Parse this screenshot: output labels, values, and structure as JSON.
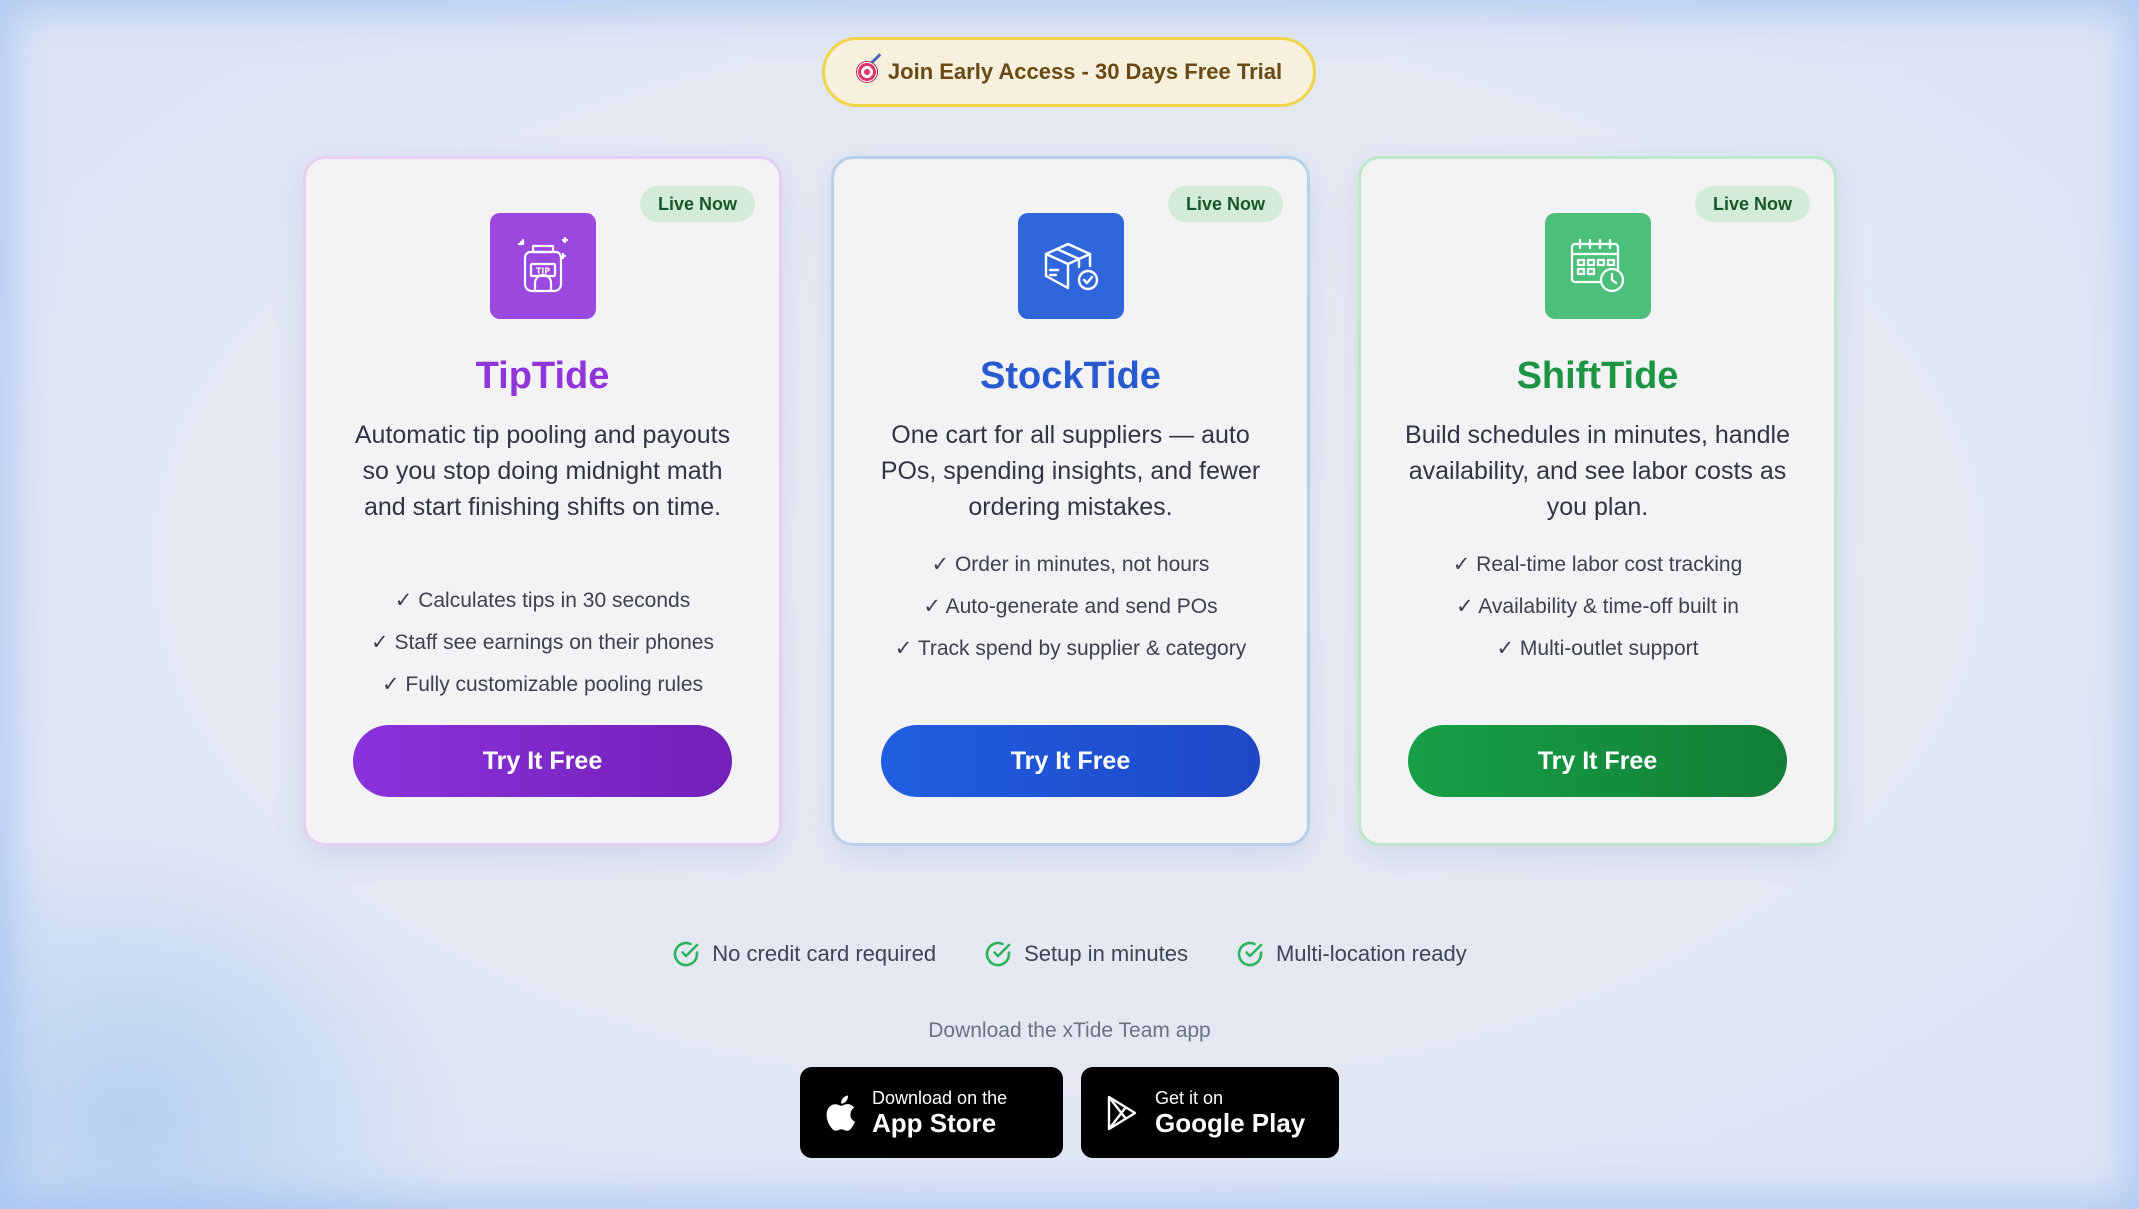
{
  "banner": {
    "text": "Join Early Access - 30 Days Free Trial",
    "icon": "target-icon"
  },
  "colors": {
    "purple": "#9b48df",
    "blue": "#2f67db",
    "green": "#4cc07a",
    "badge_border": "#f2d44a"
  },
  "cards": [
    {
      "badge": "Live Now",
      "name": "TipTide",
      "icon": "tip-jar-icon",
      "description": "Automatic tip pooling and payouts so you stop doing midnight math and start finishing shifts on time.",
      "features": [
        "✓ Calculates tips in 30 seconds",
        "✓ Staff see earnings on their phones",
        "✓ Fully customizable pooling rules"
      ],
      "cta": "Try It Free"
    },
    {
      "badge": "Live Now",
      "name": "StockTide",
      "icon": "box-check-icon",
      "description": "One cart for all suppliers — auto POs, spending insights, and fewer ordering mistakes.",
      "features": [
        "✓ Order in minutes, not hours",
        "✓ Auto-generate and send POs",
        "✓ Track spend by supplier & category"
      ],
      "cta": "Try It Free"
    },
    {
      "badge": "Live Now",
      "name": "ShiftTide",
      "icon": "calendar-clock-icon",
      "description": "Build schedules in minutes, handle availability, and see labor costs as you plan.",
      "features": [
        "✓ Real-time labor cost tracking",
        "✓ Availability & time-off built in",
        "✓ Multi-outlet support"
      ],
      "cta": "Try It Free"
    }
  ],
  "perks": [
    "No credit card required",
    "Setup in minutes",
    "Multi-location ready"
  ],
  "download": {
    "label": "Download the xTide Team app",
    "app_store": {
      "small": "Download on the",
      "big": "App Store"
    },
    "google_play": {
      "small": "Get it on",
      "big": "Google Play"
    }
  }
}
